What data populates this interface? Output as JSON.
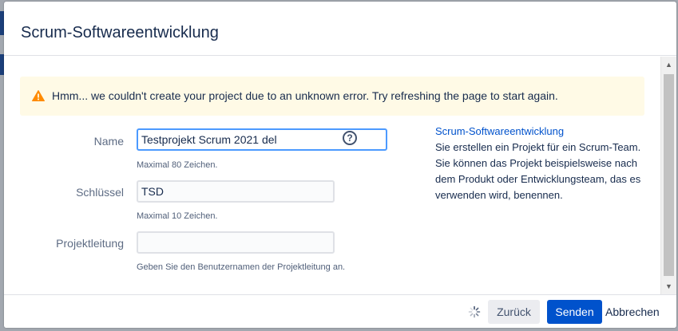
{
  "dialog": {
    "title": "Scrum-Softwareentwicklung"
  },
  "warning": {
    "icon": "warning-icon",
    "message": "Hmm... we couldn't create your project due to an unknown error. Try refreshing the page to start again."
  },
  "form": {
    "name": {
      "label": "Name",
      "value": "Testprojekt Scrum 2021 del",
      "hint": "Maximal 80 Zeichen."
    },
    "key": {
      "label": "Schlüssel",
      "value": "TSD",
      "hint": "Maximal 10 Zeichen."
    },
    "lead": {
      "label": "Projektleitung",
      "value": "",
      "hint": "Geben Sie den Benutzernamen der Projektleitung an."
    }
  },
  "side": {
    "title": "Scrum-Softwareentwicklung",
    "description": "Sie erstellen ein Projekt für ein Scrum-Team. Sie können das Projekt beispielsweise nach dem Produkt oder Entwicklungsteam, das es verwenden wird, benennen."
  },
  "footer": {
    "back_label": "Zurück",
    "send_label": "Senden",
    "cancel_label": "Abbrechen"
  },
  "colors": {
    "primary": "#0052cc",
    "warning_bg": "#fffae6",
    "warning_icon": "#ff8b00",
    "focus_border": "#4c9aff"
  }
}
